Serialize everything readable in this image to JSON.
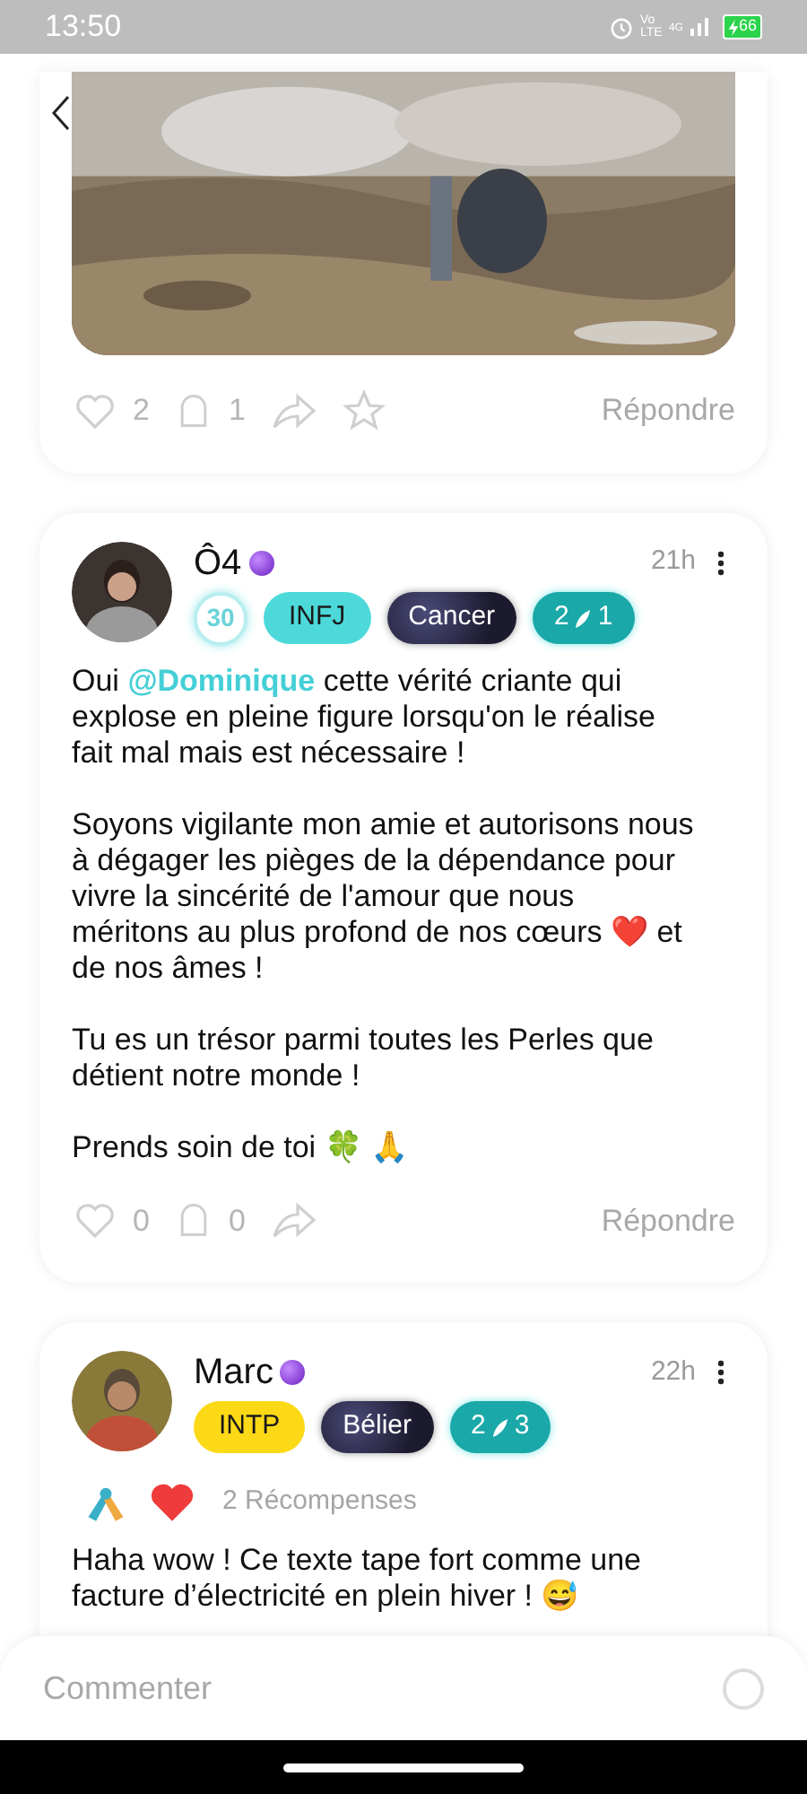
{
  "status_bar": {
    "time": "13:50",
    "network": "Vo LTE",
    "signal_label": "4G",
    "battery": "66"
  },
  "posts": [
    {
      "actions": [
        {
          "kind": "like",
          "count": "2"
        },
        {
          "kind": "ghost",
          "count": "1"
        },
        {
          "kind": "share"
        },
        {
          "kind": "star"
        }
      ],
      "reply": "Répondre"
    },
    {
      "author": "Ô4",
      "time": "21h",
      "badges": [
        {
          "kind": "level",
          "label": "30"
        },
        {
          "kind": "mbti",
          "label": "INFJ",
          "color": "#4dd9d9"
        },
        {
          "kind": "zodiac",
          "label": "Cancer"
        },
        {
          "kind": "feather",
          "before": "2",
          "after": "1"
        }
      ],
      "paragraphs": [
        [
          {
            "kind": "text",
            "text": "Oui "
          },
          {
            "kind": "mention",
            "text": "@Dominique"
          },
          {
            "kind": "text",
            "text": "  cette vérité criante qui explose en pleine figure lorsqu'on le réalise fait mal mais est nécessaire !"
          }
        ],
        [
          {
            "kind": "text",
            "text": "Soyons vigilante mon amie et autorisons nous à dégager les pièges de la dépendance pour vivre la sincérité de l'amour que nous méritons au plus profond de nos cœurs ❤️ et de nos âmes !"
          }
        ],
        [
          {
            "kind": "text",
            "text": "Tu es un trésor parmi toutes les Perles que détient notre monde !"
          }
        ],
        [
          {
            "kind": "text",
            "text": "Prends soin de toi 🍀 🙏"
          }
        ]
      ],
      "actions": [
        {
          "kind": "like",
          "count": "0"
        },
        {
          "kind": "ghost",
          "count": "0"
        },
        {
          "kind": "share"
        }
      ],
      "reply": "Répondre"
    },
    {
      "author": "Marc",
      "time": "22h",
      "badges": [
        {
          "kind": "mbti",
          "label": "INTP",
          "color": "#fcd916"
        },
        {
          "kind": "zodiac",
          "label": "Bélier"
        },
        {
          "kind": "feather",
          "before": "2",
          "after": "3"
        }
      ],
      "awards": {
        "icons": [
          {
            "kind": "handshake"
          },
          {
            "kind": "heart"
          }
        ],
        "label": "2 Récompenses"
      },
      "paragraphs": [
        [
          {
            "kind": "text",
            "text": "Haha wow ! Ce texte tape fort comme une facture d’électricité en plein hiver ! 😅"
          }
        ]
      ]
    }
  ],
  "comment_bar": {
    "placeholder": "Commenter"
  }
}
